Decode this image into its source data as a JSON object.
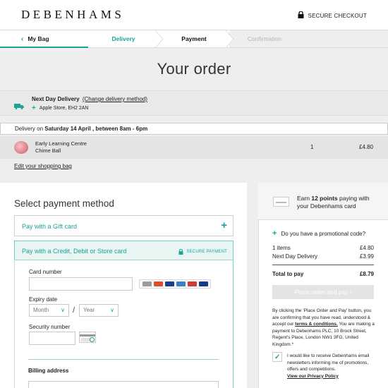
{
  "header": {
    "brand": "DEBENHAMS",
    "secure_label": "SECURE CHECKOUT"
  },
  "steps": {
    "bag": "My Bag",
    "delivery": "Delivery",
    "payment": "Payment",
    "confirmation": "Confirmation"
  },
  "order": {
    "title": "Your order",
    "delivery_title": "Next Day Delivery",
    "change_link": "(Change delivery method)",
    "store": "Apple Store, EH2 2AN",
    "delivery_prefix": "Delivery on",
    "delivery_date": "Saturday 14 April , between 8am - 6pm",
    "item_line1": "Early Learning Centre",
    "item_line2": "Chime Ball",
    "item_qty": "1",
    "item_price": "£4.80",
    "edit_link": "Edit your shopping bag"
  },
  "payment": {
    "title": "Select payment method",
    "gift_card": "Pay with a Gift card",
    "card": "Pay with a Credit, Debit or Store card",
    "secure_payment": "SECURE PAYMENT",
    "card_number_label": "Card number",
    "expiry_label": "Expiry date",
    "month_placeholder": "Month",
    "year_placeholder": "Year",
    "slash": "/",
    "security_label": "Security number",
    "billing_label": "Billing address",
    "card_logo_colors": [
      "#9b9b9b",
      "#e34a2d",
      "#1a3f8f",
      "#3b7fc6",
      "#cc3a3a",
      "#1b3a8a"
    ]
  },
  "summary": {
    "points_text_prefix": "Earn",
    "points_value": "12 points",
    "points_text_suffix": "paying with your Debenhams card",
    "promo": "Do you have a promotional code?",
    "items_label": "1 items",
    "items_value": "£4.80",
    "delivery_label": "Next Day Delivery",
    "delivery_value": "£3.99",
    "total_label": "Total to pay",
    "total_value": "£8.79",
    "order_button": "Place order and pay",
    "legal_1": "By clicking the 'Place Order and Pay' button, you are confirming that you have read, understood & accept our",
    "legal_link": "terms & conditions.",
    "legal_2": "You are making a payment to Debenhams PLC, 10 Brock Street, Regent's Place, London NW1 3FG, United Kingdom.*",
    "consent": "I would like to receive Debenhams email newsletters informing me of promotions, offers and competitions.",
    "privacy_link": "View our Privacy Policy",
    "consent_checked": true
  },
  "colors": {
    "accent": "#1aa398",
    "background_grey": "#eeeeee"
  }
}
